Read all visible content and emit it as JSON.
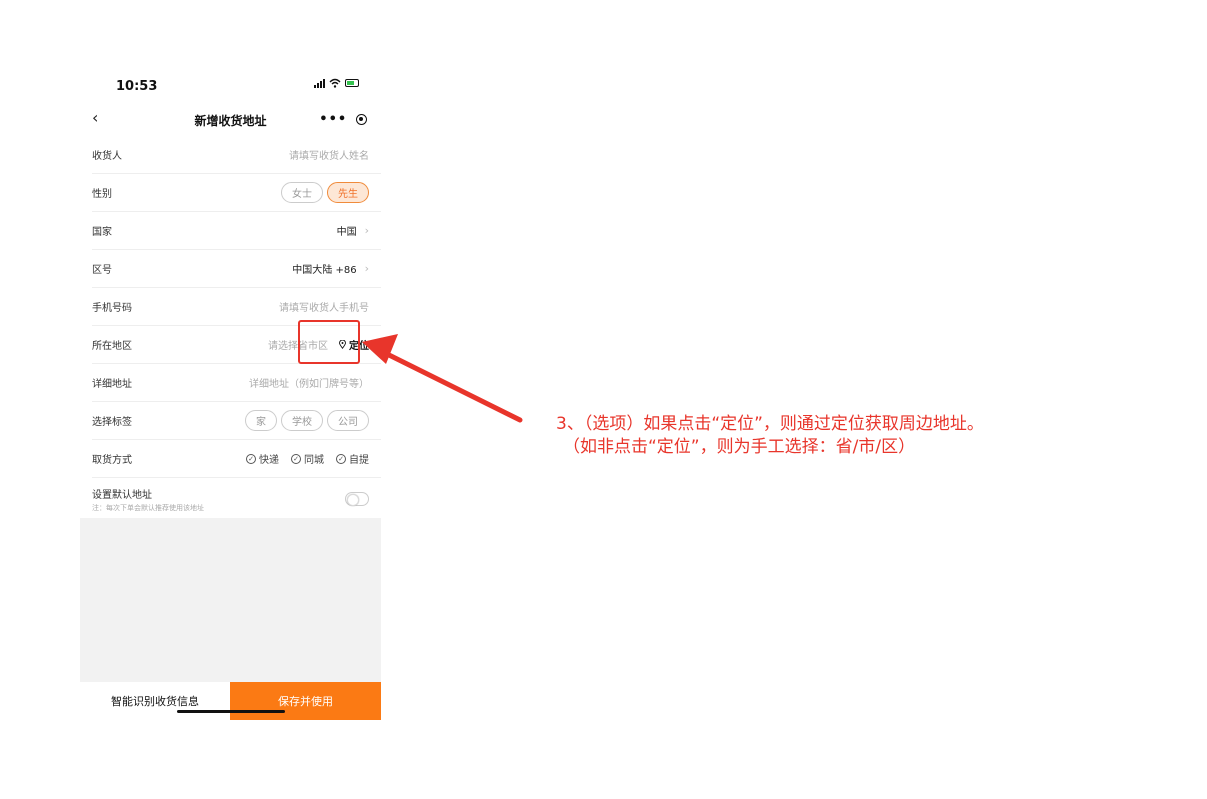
{
  "status_bar": {
    "time": "10:53"
  },
  "nav": {
    "back_icon": "‹",
    "title": "新增收货地址",
    "more_icon": "•••"
  },
  "form": {
    "receiver": {
      "label": "收货人",
      "placeholder": "请填写收货人姓名"
    },
    "gender": {
      "label": "性别",
      "options": [
        "女士",
        "先生"
      ],
      "selected": "先生"
    },
    "country": {
      "label": "国家",
      "value": "中国"
    },
    "area_code": {
      "label": "区号",
      "value": "中国大陆 +86"
    },
    "phone": {
      "label": "手机号码",
      "placeholder": "请填写收货人手机号"
    },
    "region": {
      "label": "所在地区",
      "placeholder": "请选择省市区",
      "locate_label": "定位"
    },
    "detail": {
      "label": "详细地址",
      "placeholder": "详细地址（例如门牌号等）"
    },
    "tags": {
      "label": "选择标签",
      "options": [
        "家",
        "学校",
        "公司"
      ]
    },
    "pickup": {
      "label": "取货方式",
      "options": [
        "快递",
        "同城",
        "自提"
      ]
    },
    "default": {
      "label": "设置默认地址",
      "note": "注：每次下单会默认推荐使用该地址",
      "enabled": false
    }
  },
  "bottom": {
    "smart_label": "智能识别收货信息",
    "save_label": "保存并使用"
  },
  "annotation": {
    "line1": "3、（选项）如果点击“定位”，则通过定位获取周边地址。",
    "line2": "（如非点击“定位”，则为手工选择：省/市/区）"
  },
  "colors": {
    "accent": "#fb7a14",
    "annotation": "#e8352b"
  }
}
